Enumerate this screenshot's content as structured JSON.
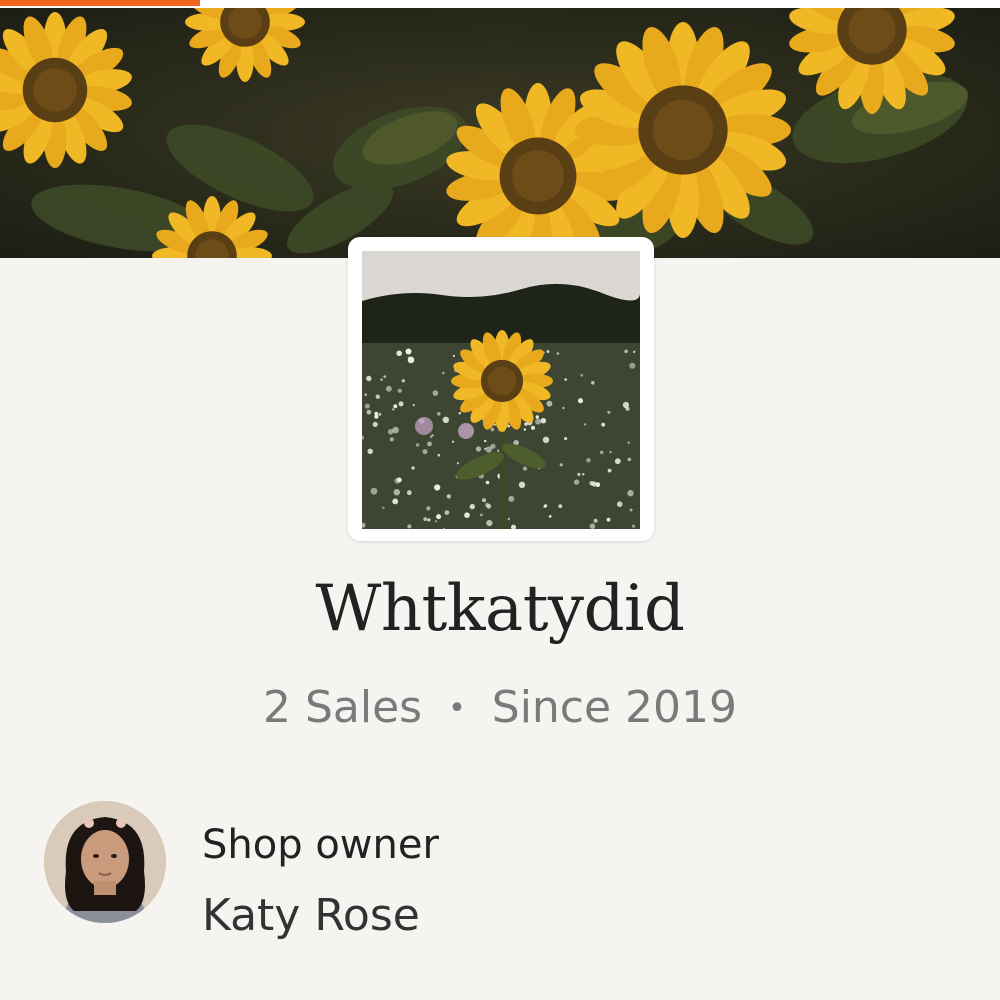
{
  "header": {
    "progress": 0.2,
    "progress_color": "#f1641e"
  },
  "banner": {
    "image": "sunflower-field-banner"
  },
  "shop": {
    "icon": "sunflower-meadow-photo",
    "name": "Whtkatydid",
    "sales": "2 Sales",
    "separator": "•",
    "since": "Since 2019"
  },
  "owner": {
    "avatar": "owner-avatar-photo",
    "role_label": "Shop owner",
    "name": "Katy Rose"
  },
  "colors": {
    "background": "#f5f4f1",
    "accent": "#f1641e",
    "title_text": "#222222",
    "meta_text": "#7a7a7a"
  }
}
